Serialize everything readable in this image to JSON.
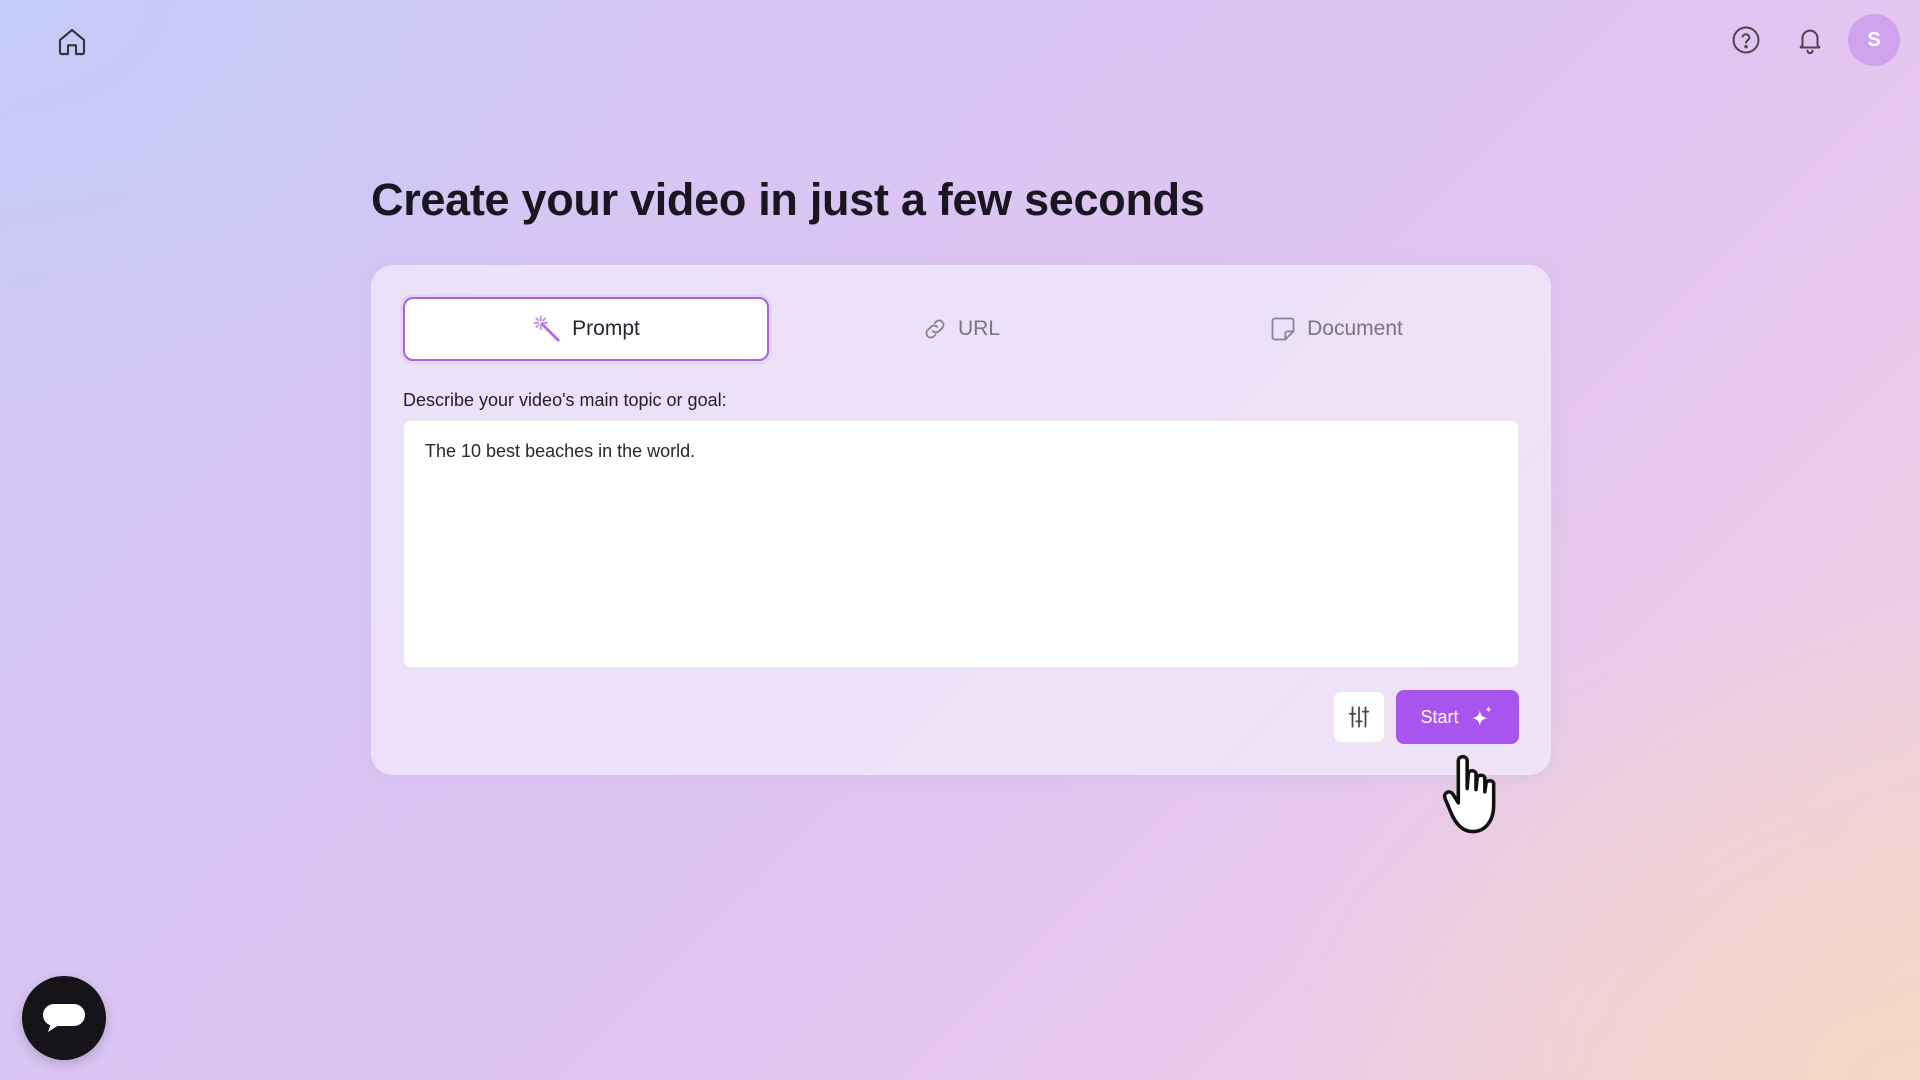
{
  "header": {
    "home_icon": "home-icon",
    "help_icon": "help-circle-icon",
    "notifications_icon": "bell-icon",
    "avatar_initial": "S"
  },
  "page": {
    "title": "Create your video in just a few seconds"
  },
  "tabs": [
    {
      "label": "Prompt",
      "icon": "magic-wand-icon",
      "active": true
    },
    {
      "label": "URL",
      "icon": "link-icon",
      "active": false
    },
    {
      "label": "Document",
      "icon": "document-icon",
      "active": false
    }
  ],
  "form": {
    "field_label": "Describe your video's main topic or goal:",
    "value": "The 10 best beaches in the world.",
    "settings_icon": "sliders-icon",
    "start_label": "Start",
    "start_icon": "sparkles-icon"
  },
  "chat_widget": {
    "icon": "chat-bubble-icon"
  },
  "colors": {
    "accent": "#a855f0",
    "active_tab_border": "#a864e6",
    "avatar_bg": "#cfa3ee",
    "chat_button_bg": "#161418"
  }
}
